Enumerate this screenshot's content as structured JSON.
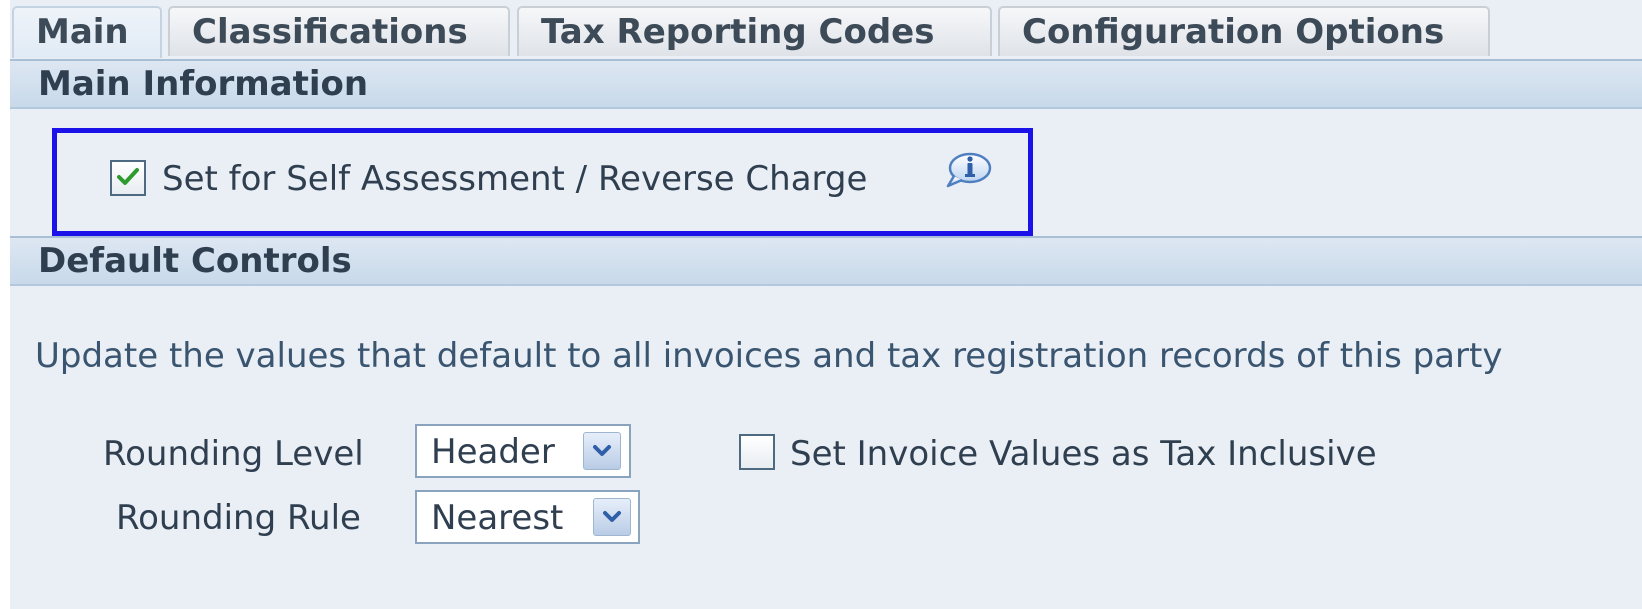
{
  "tabs": [
    {
      "label": "Main",
      "active": true
    },
    {
      "label": "Classifications",
      "active": false
    },
    {
      "label": "Tax Reporting Codes",
      "active": false
    },
    {
      "label": "Configuration Options",
      "active": false
    }
  ],
  "main_information": {
    "header": "Main Information",
    "self_assessment": {
      "label": "Set for Self Assessment / Reverse Charge",
      "checked": true
    },
    "info_icon": "info-icon",
    "highlight_color": "#1a12e8"
  },
  "default_controls": {
    "header": "Default Controls",
    "description": "Update the values that default to all invoices and tax registration records of this party",
    "rounding_level": {
      "label": "Rounding Level",
      "value": "Header"
    },
    "rounding_rule": {
      "label": "Rounding Rule",
      "value": "Nearest"
    },
    "tax_inclusive": {
      "label": "Set Invoice Values as Tax Inclusive",
      "checked": false
    }
  },
  "colors": {
    "background": "#eaeff6",
    "header_bar": "#c8d9ea",
    "text": "#2f3f50",
    "check_green": "#2e9b2e"
  }
}
